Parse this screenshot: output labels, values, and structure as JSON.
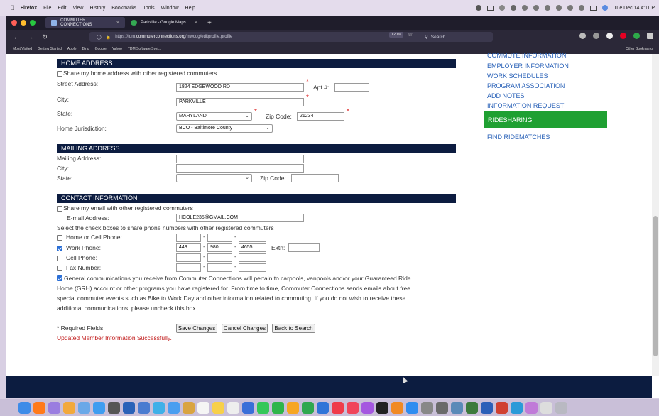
{
  "menubar": {
    "items": [
      "Firefox",
      "File",
      "Edit",
      "View",
      "History",
      "Bookmarks",
      "Tools",
      "Window",
      "Help"
    ],
    "clock": "Tue Dec 14  4:11 P"
  },
  "tabs": [
    {
      "label": "COMMUTER CONNECTIONS",
      "close": "×"
    },
    {
      "label": "Parkville - Google Maps",
      "close": "×"
    }
  ],
  "new_tab": "+",
  "nav": {
    "url_prefix": "https://tdm.",
    "url_host": "commuterconnections.org",
    "url_path": "/mwcog/editprofile.profile",
    "zoom": "120%",
    "search_placeholder": "Search"
  },
  "bookmarks": [
    "Most Visited",
    "Getting Started",
    "Apple",
    "Bing",
    "Google",
    "Yahoo",
    "TDM Software Syst..."
  ],
  "bookmarks_other": "Other Bookmarks",
  "home": {
    "header": "HOME ADDRESS",
    "share_label": "Share my home address with other registered commuters",
    "street_label": "Street Address:",
    "street_value": "1824 EDGEWOOD RD",
    "apt_label": "Apt #:",
    "apt_value": "",
    "city_label": "City:",
    "city_value": "PARKVILLE",
    "state_label": "State:",
    "state_value": "MARYLAND",
    "zip_label": "Zip Code:",
    "zip_value": "21234",
    "juris_label": "Home Jurisdiction:",
    "juris_value": "BCO - Baltimore County"
  },
  "mailing": {
    "header": "MAILING ADDRESS",
    "address_label": "Mailing Address:",
    "city_label": "City:",
    "state_label": "State:",
    "zip_label": "Zip Code:"
  },
  "contact": {
    "header": "CONTACT INFORMATION",
    "share_email_label": "Share my email with other registered commuters",
    "email_label": "E-mail Address:",
    "email_value": "HCOLE235@GMAIL.COM",
    "share_phone_text": "Select the check boxes to share phone numbers with other registered commuters",
    "home_cell_label": "Home or Cell Phone:",
    "work_label": "Work Phone:",
    "work_area": "443",
    "work_prefix": "980",
    "work_line": "4655",
    "extn_label": "Extn:",
    "cell_label": "Cell Phone:",
    "fax_label": "Fax Number:",
    "dash": "-",
    "general_line1": "General communications you receive from Commuter Connections will pertain to carpools, vanpools and/or your Guaranteed Ride",
    "general_line2": "Home (GRH) account or other programs you have registered for. From time to time, Commuter Connections sends emails about free",
    "general_line3": "special commuter events such as Bike to Work Day and other information related to commuting. If you do not wish to receive these",
    "general_line4": "additional communications, please uncheck this box."
  },
  "form_footer": {
    "required_note": "* Required Fields",
    "save": "Save Changes",
    "cancel": "Cancel Changes",
    "back": "Back to Search",
    "success": "Updated Member Information Successfully."
  },
  "sidenav": {
    "items": [
      "COMMUTE INFORMATION",
      "EMPLOYER INFORMATION",
      "WORK SCHEDULES",
      "PROGRAM ASSOCIATION",
      "ADD NOTES",
      "INFORMATION REQUEST"
    ],
    "active": "RIDESHARING",
    "after": "FIND RIDEMATCHES"
  },
  "required_mark": "*",
  "colors": {
    "header_navy": "#0c1c40",
    "active_green": "#1fa032",
    "link_blue": "#2a62b8",
    "error_red": "#c01818"
  }
}
